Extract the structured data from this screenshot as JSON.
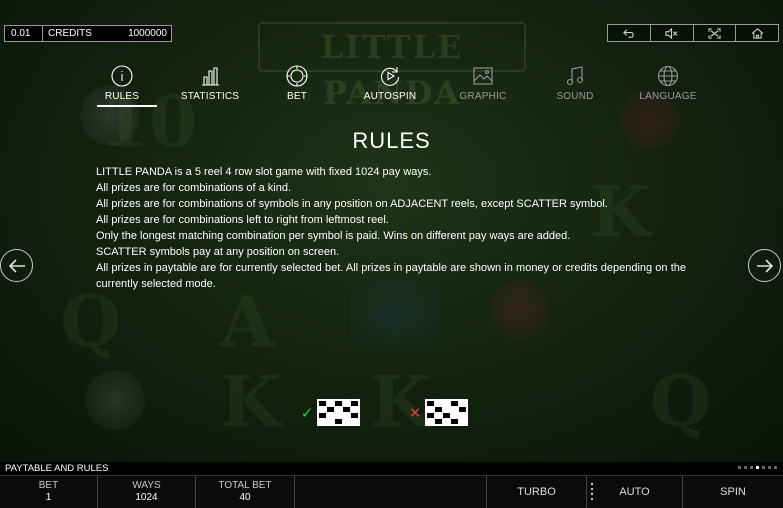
{
  "header": {
    "denomination": "0.01",
    "credits_label": "CREDITS",
    "credits_value": "1000000",
    "game_logo": "LITTLE PANDA",
    "top_icons": [
      "back-icon",
      "sound-mute-icon",
      "fullscreen-icon",
      "home-icon"
    ]
  },
  "tabs": [
    {
      "label": "RULES",
      "icon": "info-icon",
      "active": true
    },
    {
      "label": "STATISTICS",
      "icon": "bar-chart-icon",
      "active": false
    },
    {
      "label": "BET",
      "icon": "chip-icon",
      "active": false
    },
    {
      "label": "AUTOSPIN",
      "icon": "autospin-icon",
      "active": false
    },
    {
      "label": "GRAPHIC",
      "icon": "image-icon",
      "active": false
    },
    {
      "label": "SOUND",
      "icon": "music-note-icon",
      "active": false
    },
    {
      "label": "LANGUAGE",
      "icon": "globe-icon",
      "active": false
    }
  ],
  "rules": {
    "title": "RULES",
    "lines": [
      "LITTLE PANDA is a 5 reel 4 row slot game with fixed 1024 pay ways.",
      "All prizes are for combinations of a kind.",
      "All prizes are for combinations of symbols in any position on ADJACENT reels, except SCATTER symbol.",
      "All prizes are for combinations left to right from leftmost reel.",
      "Only the longest matching combination per symbol is paid. Wins on different pay ways are added.",
      "SCATTER symbols pay at any position on screen.",
      "All prizes in paytable are for currently selected bet. All prizes in paytable are shown in money or credits depending on the currently selected mode."
    ],
    "examples": [
      {
        "mark": "✓",
        "color": "#2ecc40",
        "valid": true
      },
      {
        "mark": "✕",
        "color": "#e53935",
        "valid": false
      }
    ]
  },
  "navigation": {
    "prev": "arrow-left-icon",
    "next": "arrow-right-icon"
  },
  "footer": {
    "paytable_label": "PAYTABLE AND RULES",
    "page_count": 7,
    "current_page": 4,
    "bet_label": "BET",
    "bet_value": "1",
    "ways_label": "WAYS",
    "ways_value": "1024",
    "total_bet_label": "TOTAL BET",
    "total_bet_value": "40",
    "turbo_label": "TURBO",
    "auto_label": "AUTO",
    "spin_label": "SPIN"
  }
}
